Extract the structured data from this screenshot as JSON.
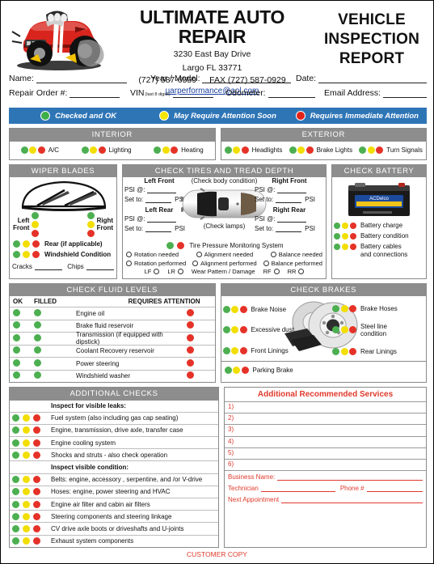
{
  "shop": {
    "name": "ULTIMATE AUTO REPAIR",
    "address_line1": "3230 East Bay Drive",
    "address_line2": "Largo FL 33771",
    "phone": "(727) 587-6559",
    "fax": "FAX (727) 587-0929",
    "email": "uarperformance@aol.com",
    "doc_title": "VEHICLE INSPECTION REPORT",
    "logo_name": "cartoon-muscle-car-logo"
  },
  "fields": {
    "name": "Name:",
    "year_model": "Year / Model:",
    "date": "Date:",
    "repair_order": "Repair Order #:",
    "vin": "VIN",
    "vin_note": "(last 8 digits)",
    "odometer": "Odometer:",
    "email_address": "Email Address:"
  },
  "legend": {
    "items": [
      {
        "label": "Checked and OK",
        "color": "#3FAE49"
      },
      {
        "label": "May Require Attention Soon",
        "color": "#F3E600"
      },
      {
        "label": "Requires Immediate Attention",
        "color": "#E2231A"
      }
    ],
    "bar_color": "#2E75B6"
  },
  "interior": {
    "title": "INTERIOR",
    "items": [
      "A/C",
      "Lighting",
      "Heating"
    ]
  },
  "exterior": {
    "title": "EXTERIOR",
    "items": [
      "Headlights",
      "Brake Lights",
      "Turn Signals"
    ]
  },
  "wipers": {
    "title": "WIPER BLADES",
    "left_label_1": "Left",
    "left_label_2": "Front",
    "right_label_1": "Right",
    "right_label_2": "Front",
    "rear": "Rear (if applicable)",
    "windshield": "Windshield Condition",
    "cracks": "Cracks",
    "chips": "Chips"
  },
  "tires": {
    "title": "CHECK TIRES AND TREAD DEPTH",
    "left_front": "Left Front",
    "right_front": "Right Front",
    "left_rear": "Left Rear",
    "right_rear": "Right Rear",
    "psi_at": "PSI @:",
    "set_to": "Set to:",
    "psi": "PSI",
    "check_body": "(Check body condition)",
    "check_lamps": "(Check lamps)",
    "tpms": "Tire Pressure Monitoring System",
    "rotation_needed": "Rotation needed",
    "alignment_needed": "Alignment needed",
    "balance_needed": "Balance needed",
    "rotation_performed": "Rotation performed",
    "alignment_performed": "Alignment  performed",
    "balance_performed": "Balance  performed",
    "lf": "LF",
    "lr": "LR",
    "wear_pattern": "Wear Pattern / Damage",
    "rf": "RF",
    "rr": "RR"
  },
  "battery": {
    "title": "CHECK BATTERY",
    "art_name": "car-battery-image",
    "items": [
      "Battery charge",
      "Battery condition",
      "Battery cables and connections"
    ]
  },
  "fluids": {
    "title": "CHECK FLUID LEVELS",
    "col_ok": "OK",
    "col_filled": "FILLED",
    "col_attention": "REQUIRES ATTENTION",
    "rows": [
      "Engine oil",
      "Brake fluid reservoir",
      "Transmission (if equipped with dipstick)",
      "Coolant Recovery reservoir",
      "Power steering",
      "Windshield washer"
    ]
  },
  "brakes": {
    "title": "CHECK BRAKES",
    "art_name": "brake-rotor-and-pads-image",
    "left_items": [
      "Brake Noise",
      "Excessive dust",
      "Front Linings"
    ],
    "right_items": [
      "Brake Hoses",
      "Steel line condition",
      "Rear Linings"
    ],
    "parking_brake": "Parking Brake"
  },
  "additional_checks": {
    "title": "ADDITIONAL CHECKS",
    "rows": [
      {
        "text": "Inspect for visible leaks:",
        "type": "subhead"
      },
      {
        "text": "Fuel system (also including gas cap seating)",
        "type": "item"
      },
      {
        "text": "Engine, transmission, drive axle, transfer case",
        "type": "item"
      },
      {
        "text": "Engine cooling system",
        "type": "item"
      },
      {
        "text": "Shocks and struts -  also check operation",
        "type": "item"
      },
      {
        "text": "Inspect visible condition:",
        "type": "subhead"
      },
      {
        "text": "Belts:  engine, accessory , serpentine, and /or V-drive",
        "type": "item"
      },
      {
        "text": "Hoses:  engine, power steering and HVAC",
        "type": "item"
      },
      {
        "text": "Engine air filter and cabin air filters",
        "type": "item"
      },
      {
        "text": "Steering components and steering linkage",
        "type": "item"
      },
      {
        "text": "CV drive axle boots or driveshafts and U-joints",
        "type": "item"
      },
      {
        "text": "Exhaust system components",
        "type": "item"
      }
    ]
  },
  "services": {
    "title": "Additional Recommended Services",
    "accent": "#E0392C",
    "lines": [
      "1)",
      "2)",
      "3)",
      "4)",
      "5)",
      "6)"
    ],
    "business_name": "Business Name:",
    "technician": "Technician",
    "phone": "Phone #",
    "next_appointment": "Next Appointment"
  },
  "footer": {
    "text": "CUSTOMER COPY"
  }
}
